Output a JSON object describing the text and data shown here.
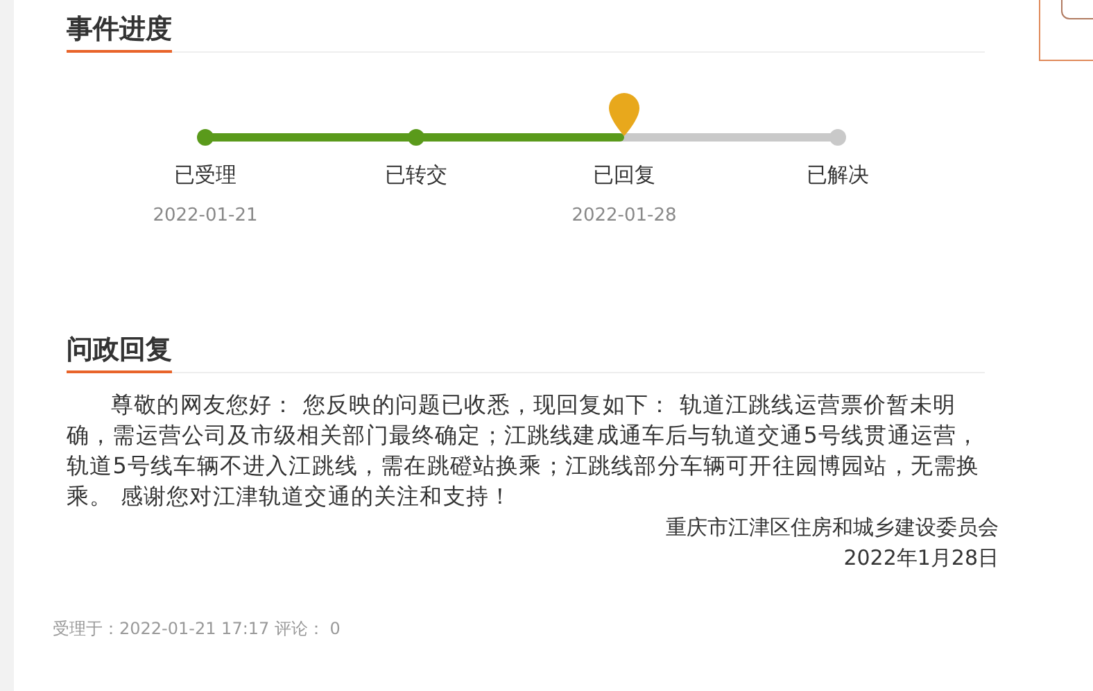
{
  "progress": {
    "title": "事件进度",
    "steps": [
      {
        "label": "已受理",
        "date": "2022-01-21",
        "done": true,
        "current": false
      },
      {
        "label": "已转交",
        "done": true,
        "current": false
      },
      {
        "label": "已回复",
        "date": "2022-01-28",
        "done": true,
        "current": true
      },
      {
        "label": "已解决",
        "done": false,
        "current": false
      }
    ]
  },
  "reply": {
    "title": "问政回复",
    "body": "尊敬的网友您好： 您反映的问题已收悉，现回复如下： 轨道江跳线运营票价暂未明确，需运营公司及市级相关部门最终确定；江跳线建成通车后与轨道交通5号线贯通运营，轨道5号线车辆不进入江跳线，需在跳磴站换乘；江跳线部分车辆可开往园博园站，无需换乘。 感谢您对江津轨道交通的关注和支持！",
    "signature": "重庆市江津区住房和城乡建设委员会",
    "date": "2022年1月28日"
  },
  "footer": "受理于：2022-01-21 17:17 评论： 0"
}
